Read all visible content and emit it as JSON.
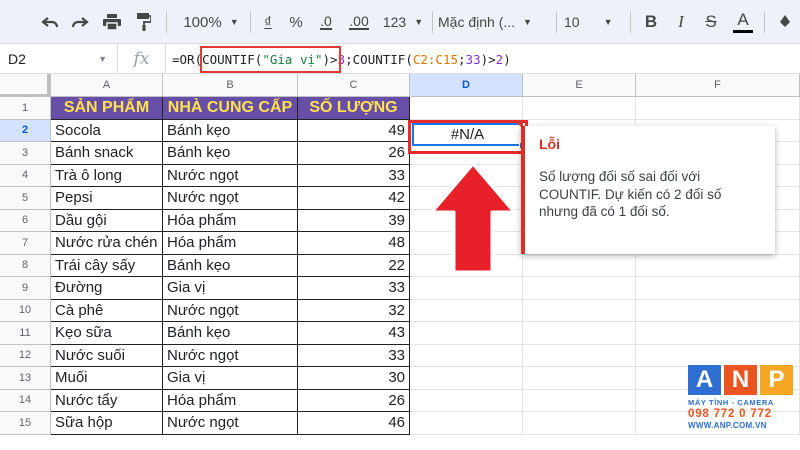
{
  "toolbar": {
    "zoom": "100%",
    "currency_symbol": "₫",
    "percent_symbol": "%",
    "decrease_decimal": ".0",
    "increase_decimal": ".00",
    "more_formats": "123",
    "font_name": "Mặc định (...",
    "font_size": "10",
    "bold": "B",
    "italic": "I",
    "strikethrough": "S",
    "text_color": "A",
    "underline_color": "#000000"
  },
  "formula_bar": {
    "cell_ref": "D2",
    "fx": "fx",
    "formula_parts": [
      {
        "text": "=OR(COUNTIF(",
        "kind": "plain"
      },
      {
        "text": "\"Gia vị\"",
        "kind": "string"
      },
      {
        "text": ")>",
        "kind": "plain"
      },
      {
        "text": "3",
        "kind": "number"
      },
      {
        "text": ";COUNTIF(",
        "kind": "plain"
      },
      {
        "text": "C2:C15",
        "kind": "ref"
      },
      {
        "text": ";",
        "kind": "plain"
      },
      {
        "text": "33",
        "kind": "number"
      },
      {
        "text": ")>",
        "kind": "plain"
      },
      {
        "text": "2",
        "kind": "number"
      },
      {
        "text": ")",
        "kind": "plain"
      }
    ]
  },
  "columns": [
    "A",
    "B",
    "C",
    "D",
    "E",
    "F"
  ],
  "selected_column": "D",
  "selected_row": "2",
  "headers": {
    "a": "SẢN PHẨM",
    "b": "NHÀ CUNG CẤP",
    "c": "SỐ LƯỢNG"
  },
  "rows": [
    {
      "n": "1"
    },
    {
      "n": "2",
      "product": "Socola",
      "supplier": "Bánh kẹo",
      "qty": "49"
    },
    {
      "n": "3",
      "product": "Bánh snack",
      "supplier": "Bánh kẹo",
      "qty": "26"
    },
    {
      "n": "4",
      "product": "Trà ô long",
      "supplier": "Nước ngọt",
      "qty": "33"
    },
    {
      "n": "5",
      "product": "Pepsi",
      "supplier": "Nước ngọt",
      "qty": "42"
    },
    {
      "n": "6",
      "product": "Dầu gội",
      "supplier": "Hóa phẩm",
      "qty": "39"
    },
    {
      "n": "7",
      "product": "Nước rửa chén",
      "supplier": "Hóa phẩm",
      "qty": "48"
    },
    {
      "n": "8",
      "product": "Trái cây sấy",
      "supplier": "Bánh kẹo",
      "qty": "22"
    },
    {
      "n": "9",
      "product": "Đường",
      "supplier": "Gia vị",
      "qty": "33"
    },
    {
      "n": "10",
      "product": "Cà phê",
      "supplier": "Nước ngọt",
      "qty": "32"
    },
    {
      "n": "11",
      "product": "Kẹo sữa",
      "supplier": "Bánh kẹo",
      "qty": "43"
    },
    {
      "n": "12",
      "product": "Nước suối",
      "supplier": "Nước ngọt",
      "qty": "33"
    },
    {
      "n": "13",
      "product": "Muối",
      "supplier": "Gia vị",
      "qty": "30"
    },
    {
      "n": "14",
      "product": "Nước tẩy",
      "supplier": "Hóa phẩm",
      "qty": "26"
    },
    {
      "n": "15",
      "product": "Sữa hộp",
      "supplier": "Nước ngọt",
      "qty": "46"
    }
  ],
  "active_cell_value": "#N/A",
  "error": {
    "title": "Lỗi",
    "message": "Số lượng đối số sai đối với COUNTIF. Dự kiến có 2 đối số nhưng đã có 1 đối số."
  },
  "logo": {
    "letters": [
      "A",
      "N",
      "P"
    ],
    "tagline": "MÁY TÍNH - CAMERA",
    "phone": "098 772 0 772",
    "website": "WWW.ANP.COM.VN"
  },
  "colors": {
    "header_bg": "#674ea7",
    "header_text": "#ffe14d",
    "error_red": "#d93025",
    "selection_blue": "#1a73e8",
    "arrow_red": "#e52b2b"
  }
}
